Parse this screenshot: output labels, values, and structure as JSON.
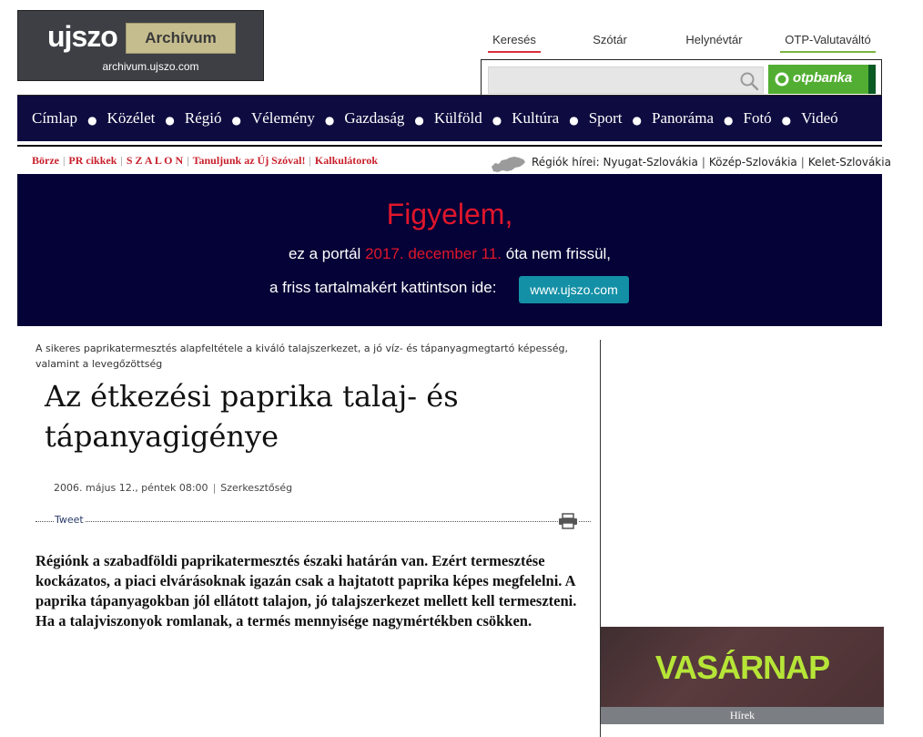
{
  "header": {
    "logo": "ujszo",
    "archive_label": "Archívum",
    "archive_url": "archivum.ujszo.com"
  },
  "top_links": [
    "Keresés",
    "Szótár",
    "Helynévtár",
    "OTP-Valutaváltó"
  ],
  "search": {
    "value": "",
    "icon": "search-icon"
  },
  "sponsor": {
    "text": "otpbanka",
    "color": "#52ae32"
  },
  "nav": {
    "items": [
      "Címlap",
      "Közélet",
      "Régió",
      "Vélemény",
      "Gazdaság",
      "Külföld",
      "Kultúra",
      "Sport",
      "Panoráma",
      "Fotó",
      "Videó"
    ],
    "background": "#0d0b3f"
  },
  "sub_links": [
    "Börze",
    "PR cikkek",
    "S Z A L O N",
    "Tanuljunk az Új Szóval!",
    "Kalkulátorok"
  ],
  "regions": {
    "prefix": "Régiók hírei:",
    "items": [
      "Nyugat-Szlovákia",
      "Közép-Szlovákia",
      "Kelet-Szlovákia"
    ]
  },
  "notice": {
    "title": "Figyelem,",
    "line1_before": "ez a portál ",
    "date": "2017. december 11.",
    "line1_after": " óta nem frissül,",
    "line2": "a friss tartalmakért kattintson ide:",
    "button": "www.ujszo.com",
    "accent": "#e0162b"
  },
  "article": {
    "lead": "A sikeres paprikatermesztés alapfeltétele a kiváló talajszerkezet, a jó víz- és tápanyagmegtartó képesség, valamint a levegőzöttség",
    "title": "Az étkezési paprika talaj- és tápanyagigénye",
    "date": "2006. május 12., péntek 08:00",
    "author": "Szerkesztőség",
    "tweet": "Tweet",
    "body": "Régiónk a szabadföldi paprikatermesztés északi határán van. Ezért termesztése kockázatos, a piaci elvárásoknak igazán csak a hajtatott paprika képes megfelelni. A paprika tápanyagokban jól ellátott talajon, jó talajszerkezet mellett kell termeszteni. Ha a talajviszonyok romlanak, a termés mennyisége nagymértékben csökken."
  },
  "sidebar": {
    "ad_title": "VASÁRNAP",
    "ad_caption": "Hírek",
    "ad_accent": "#b6e537"
  }
}
